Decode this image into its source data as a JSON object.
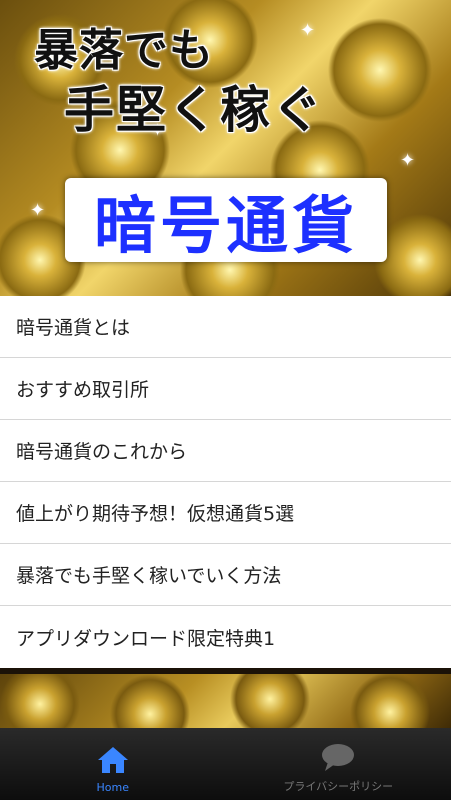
{
  "header": {
    "title_line1": "暴落でも",
    "title_line2": "手堅く稼ぐ",
    "badge_text": "暗号通貨"
  },
  "menu": {
    "items": [
      {
        "label": "暗号通貨とは"
      },
      {
        "label": "おすすめ取引所"
      },
      {
        "label": "暗号通貨のこれから"
      },
      {
        "label": "値上がり期待予想！仮想通貨5選"
      },
      {
        "label": "暴落でも手堅く稼いでいく方法"
      },
      {
        "label": "アプリダウンロード限定特典1"
      }
    ]
  },
  "tabbar": {
    "tabs": [
      {
        "label": "Home",
        "icon": "home-icon",
        "active": true
      },
      {
        "label": "プライバシーポリシー",
        "icon": "speech-bubble-icon",
        "active": false
      }
    ]
  },
  "colors": {
    "badge_text": "#1d30ff",
    "tab_active": "#3a86ff",
    "tab_inactive": "#777777"
  }
}
